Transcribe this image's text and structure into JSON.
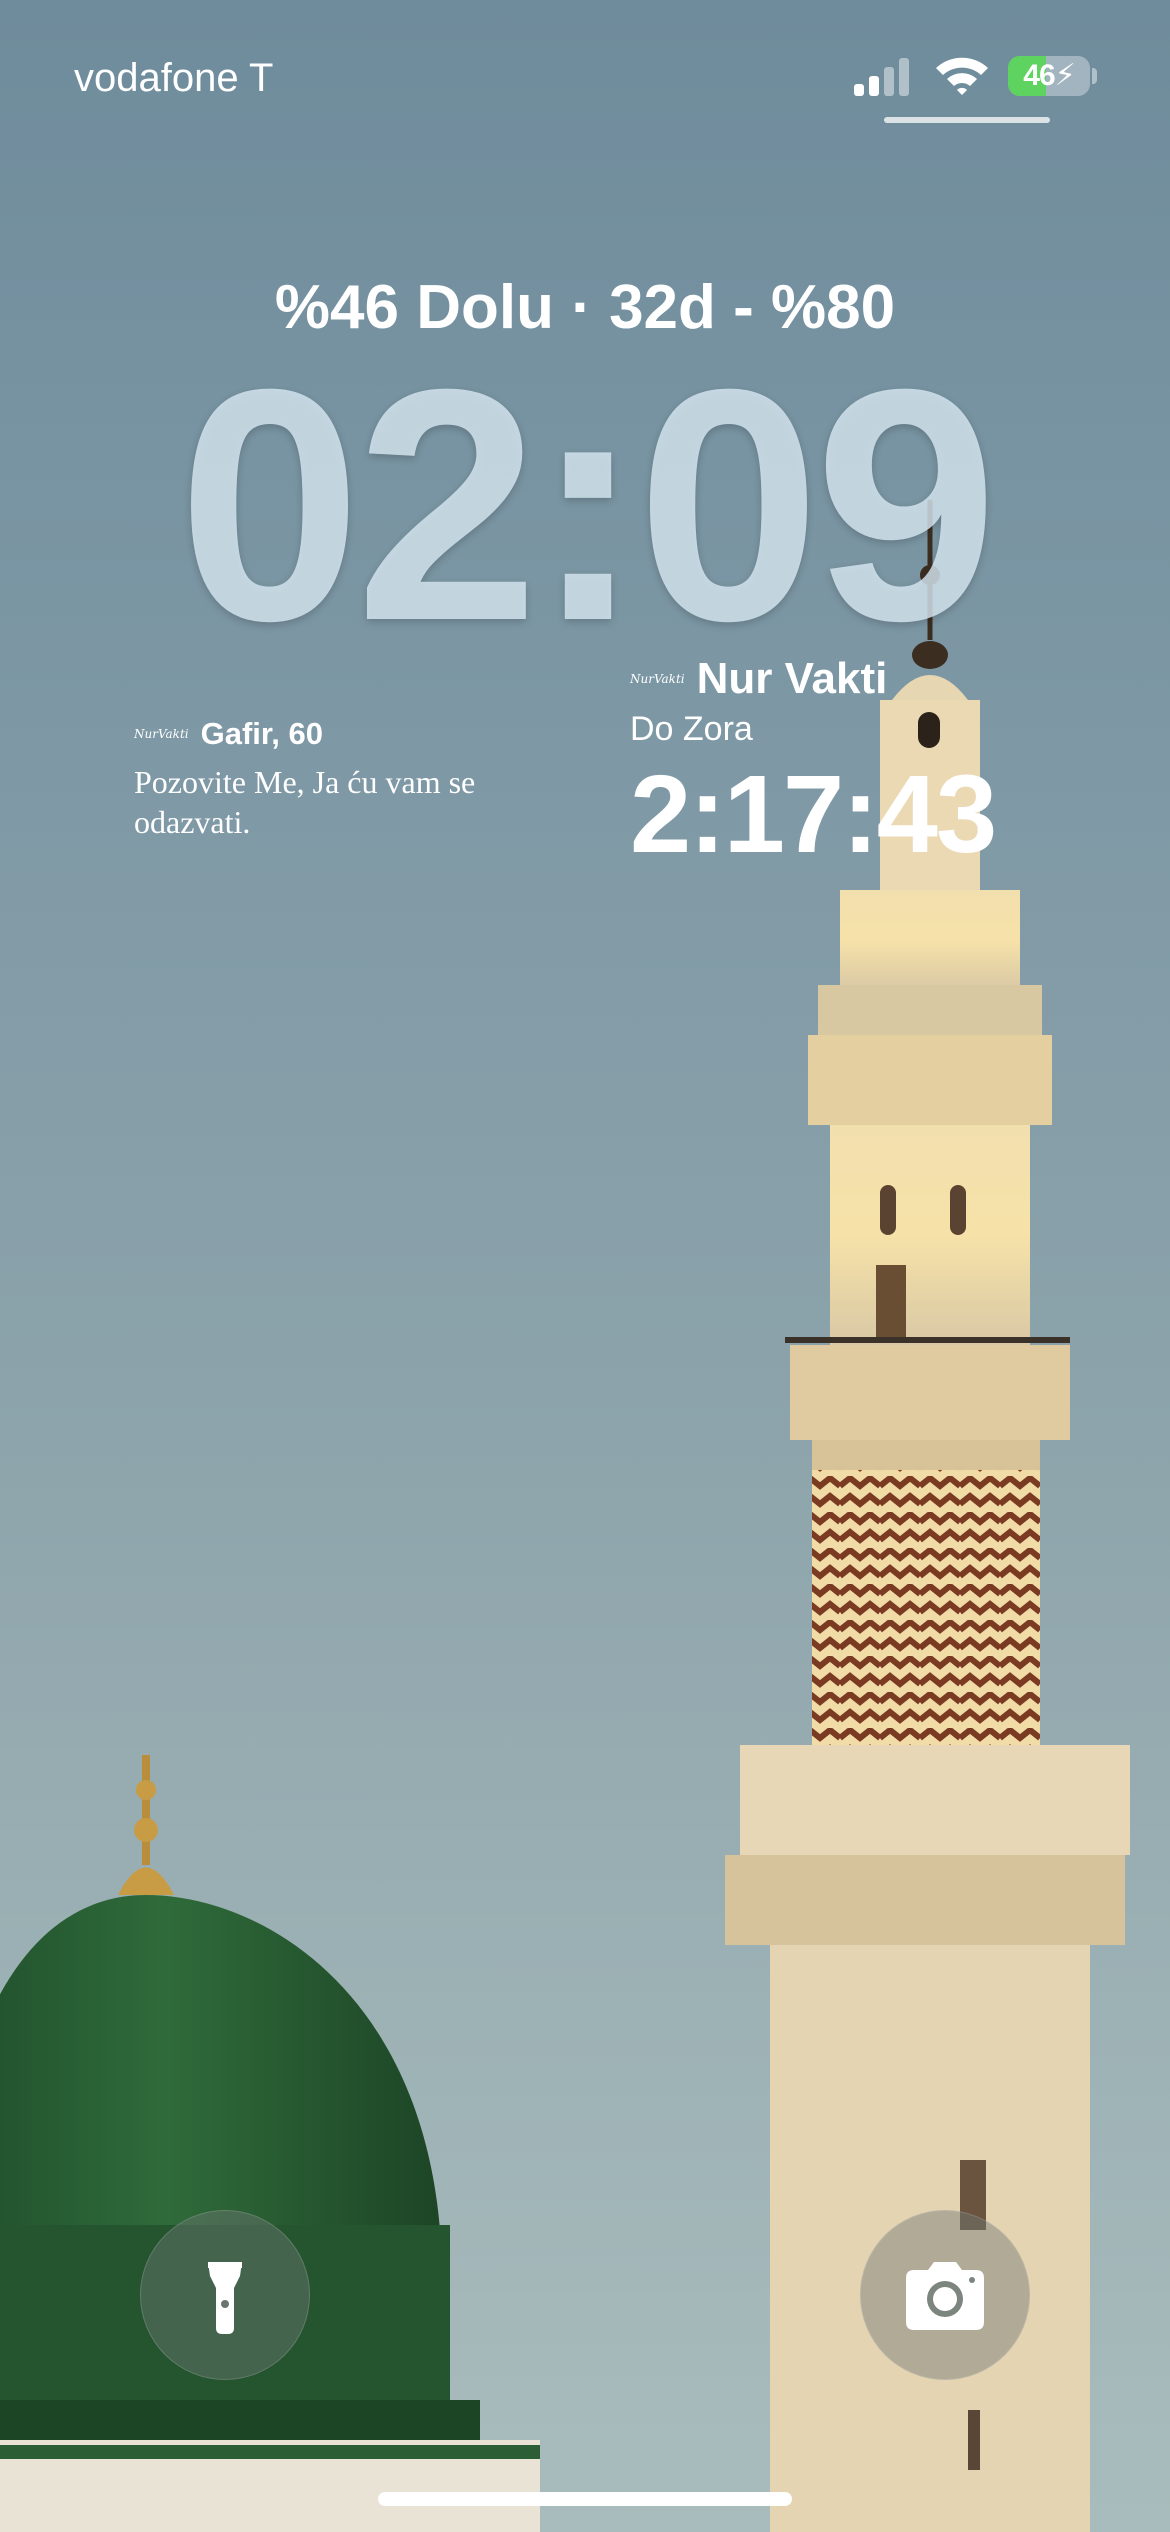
{
  "status_bar": {
    "carrier": "vodafone T",
    "battery_percent": "46",
    "battery_level": 0.46,
    "charging": true,
    "icons": [
      "cellular-signal-icon",
      "wifi-icon",
      "battery-icon",
      "charging-bolt-icon"
    ]
  },
  "lock_screen": {
    "battery_widget": "%46 Dolu · 32d - %80",
    "time": "02:09"
  },
  "verse_widget": {
    "app_logo": "NurVakti",
    "reference": "Gafir, 60",
    "text": "Pozovite Me, Ja ću vam se odazvati."
  },
  "prayer_widget": {
    "app_logo": "NurVakti",
    "app_name": "Nur Vakti",
    "label": "Do Zora",
    "countdown": "2:17:43"
  },
  "quick_actions": {
    "left": "flashlight-icon",
    "right": "camera-icon"
  },
  "colors": {
    "sky": "#7e98a5",
    "dome_green": "#2f6b3a",
    "minaret": "#e8d9b6",
    "battery_green": "#5fd35f"
  }
}
